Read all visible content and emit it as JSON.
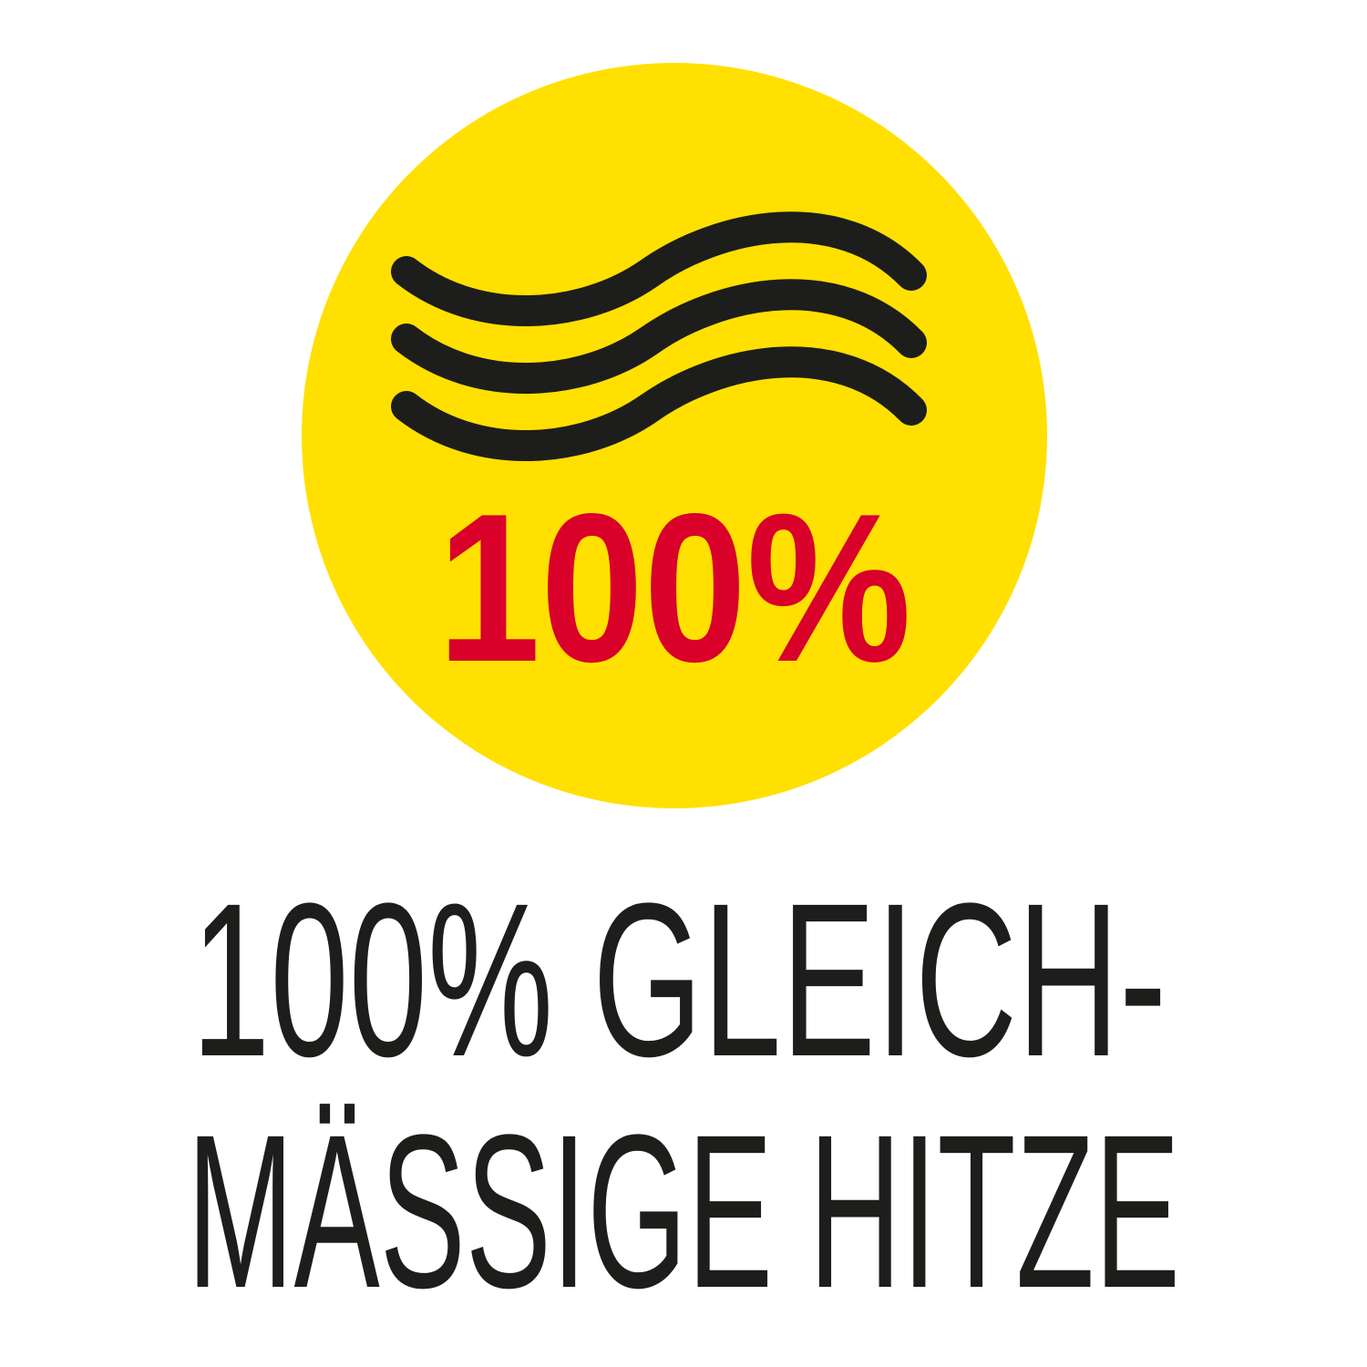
{
  "badge": {
    "percent_label": "100%",
    "icon": "heat-waves-icon"
  },
  "caption": {
    "line1": "100% GLEICH-",
    "line2": "MÄSSIGE HITZE"
  },
  "colors": {
    "background": "#ffffff",
    "circle": "#ffe000",
    "waves": "#1d1d1b",
    "percent": "#d9002a",
    "caption": "#1d1d1b"
  }
}
